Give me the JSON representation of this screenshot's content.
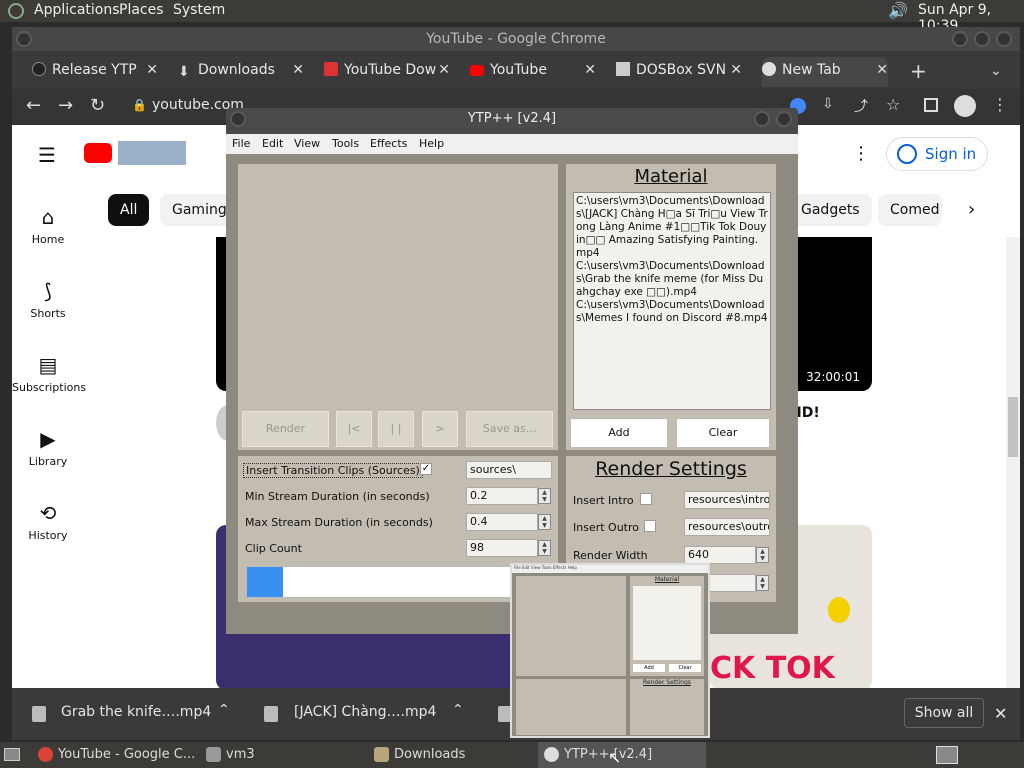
{
  "top_panel": {
    "menus": [
      "Applications",
      "Places",
      "System"
    ],
    "clock": "Sun Apr  9, 10:39"
  },
  "chrome": {
    "title": "YouTube - Google Chrome",
    "tabs": [
      {
        "label": "Release YTP"
      },
      {
        "label": "Downloads"
      },
      {
        "label": "YouTube Dow"
      },
      {
        "label": "YouTube"
      },
      {
        "label": "DOSBox SVN"
      },
      {
        "label": "New Tab"
      }
    ],
    "url": "youtube.com"
  },
  "youtube": {
    "sidebar": [
      {
        "label": "Home",
        "icon": "home-icon"
      },
      {
        "label": "Shorts",
        "icon": "shorts-icon"
      },
      {
        "label": "Subscriptions",
        "icon": "subscriptions-icon"
      },
      {
        "label": "Library",
        "icon": "library-icon"
      },
      {
        "label": "History",
        "icon": "history-icon"
      }
    ],
    "chips": [
      "All",
      "Gaming",
      "Gadgets",
      "Comed"
    ],
    "sign_in": "Sign in",
    "duration": "32:00:01",
    "title_fragment": "HD!",
    "thumb_text": "CK TOK"
  },
  "ytp": {
    "title": "YTP++ [v2.4]",
    "menu": [
      "File",
      "Edit",
      "View",
      "Tools",
      "Effects",
      "Help"
    ],
    "buttons": {
      "render": "Render",
      "prev": "|<",
      "pause": "| |",
      "play": ">",
      "save": "Save as..."
    },
    "material": {
      "heading": "Material",
      "items": [
        "C:\\users\\vm3\\Documents\\Downloads\\[JACK] Chàng H□a Sĩ Tri□u View Trong Làng Anime #1□□Tik Tok Douyin□□ Amazing Satisfying Painting.mp4",
        "C:\\users\\vm3\\Documents\\Downloads\\Grab the knife meme (for Miss Duahgchay exe □□).mp4",
        "C:\\users\\vm3\\Documents\\Downloads\\Memes I found on Discord #8.mp4"
      ],
      "add": "Add",
      "clear": "Clear"
    },
    "settings": {
      "transition_label": "Insert Transition Clips (Sources)",
      "transition_path": "sources\\",
      "min_label": "Min Stream Duration (in seconds)",
      "min_value": "0.2",
      "max_label": "Max Stream Duration (in seconds)",
      "max_value": "0.4",
      "clip_label": "Clip Count",
      "clip_value": "98",
      "progress": 0.12
    },
    "render_settings": {
      "heading": "Render Settings",
      "intro_label": "Insert Intro",
      "intro_path": "resources\\intro.m",
      "outro_label": "Insert Outro",
      "outro_path": "resources\\outro.m",
      "width_label": "Render Width",
      "width_value": "640"
    }
  },
  "shelf": {
    "items": [
      "Grab the knife….mp4",
      "[JACK] Chàng….mp4"
    ],
    "show_all": "Show all"
  },
  "taskbar": {
    "items": [
      "YouTube - Google C...",
      "vm3",
      "Downloads",
      "YTP++ [v2.4]"
    ]
  },
  "preview": {
    "menu": "File  Edit  View  Tools  Effects  Help",
    "material": "Material",
    "render_settings": "Render Settings",
    "add": "Add",
    "clear": "Clear"
  }
}
